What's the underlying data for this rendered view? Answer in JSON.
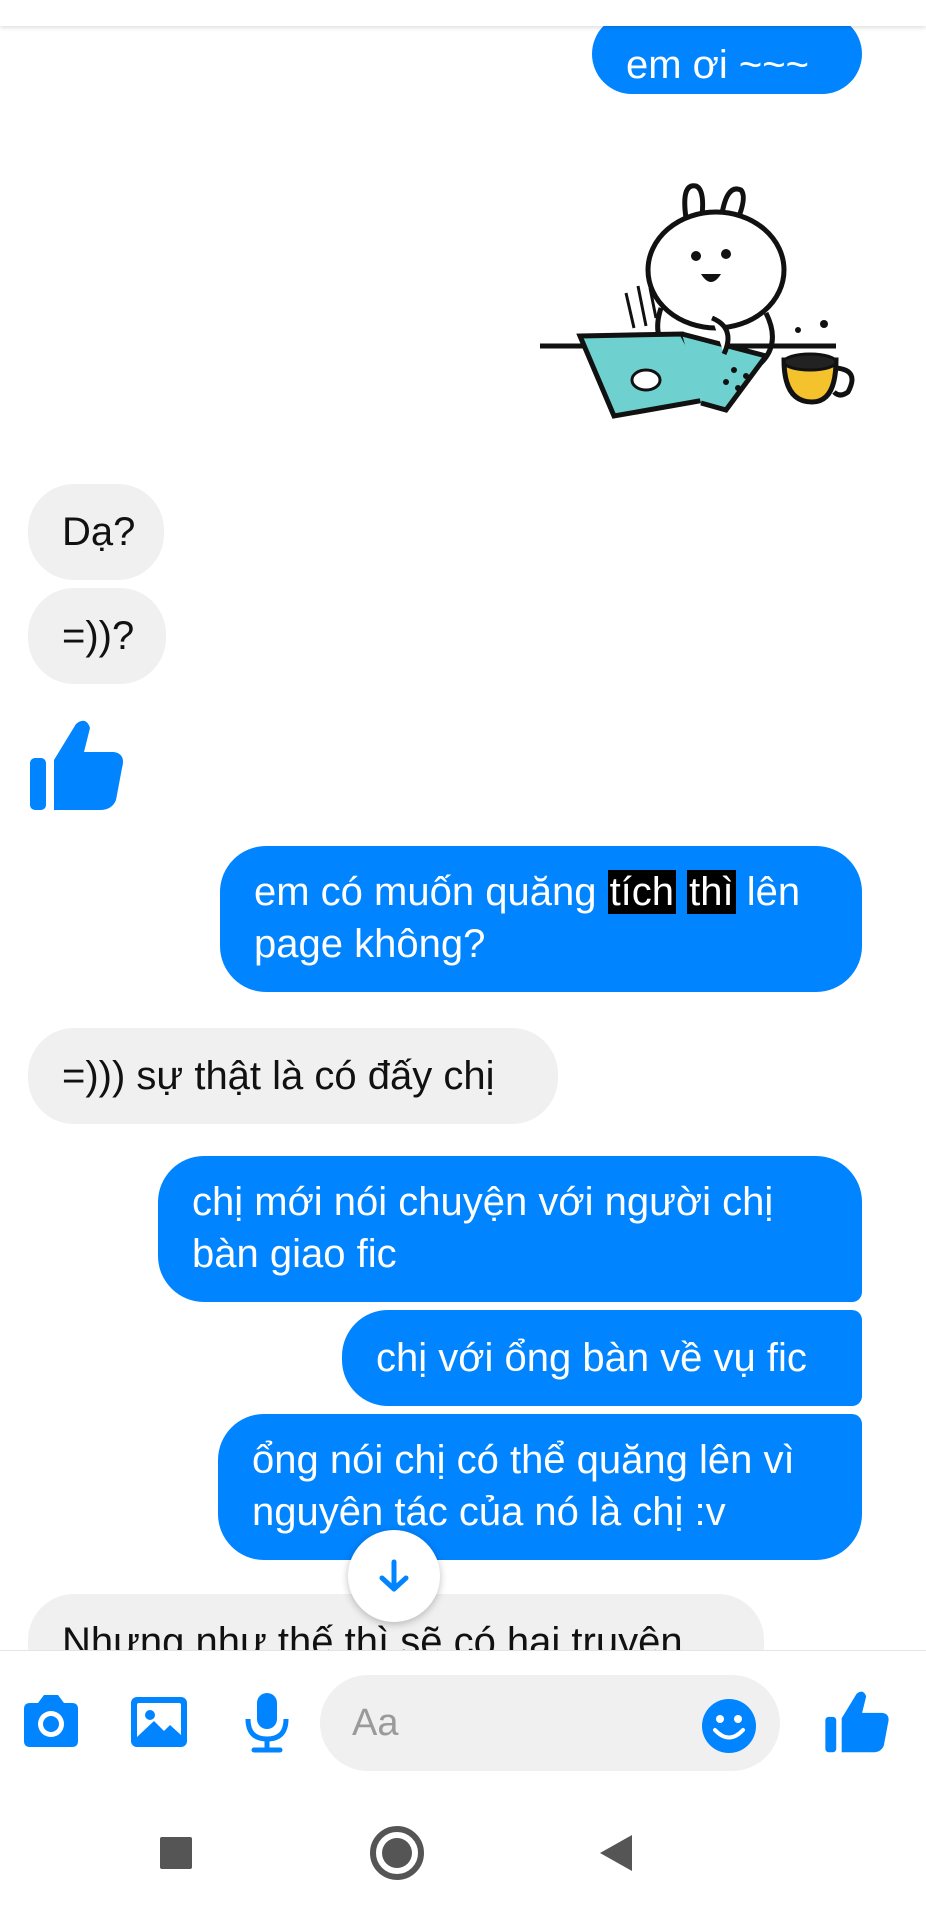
{
  "messages": {
    "m1": "em ơi ~~~",
    "m2": "Dạ?",
    "m3": "=))?",
    "m4_pre": "em có muốn quăng ",
    "m4_hl1": "tích",
    "m4_hl2": "thì",
    "m4_post": " lên",
    "m4_line2": "page không?",
    "m5": "=))) sự thật là có đấy chị",
    "m6_line1": "chị mới nói chuyện với người chị",
    "m6_line2": "bàn giao fic",
    "m7": "chị với ổng bàn về vụ fic",
    "m8_line1": "ổng nói chị có thể quăng lên vì",
    "m8_line2": "nguyên tác của nó là chị :v",
    "m9": "Nhưng như thế thì sẽ có hai truyện"
  },
  "composer": {
    "placeholder": "Aa"
  },
  "colors": {
    "outgoing": "#0084ff",
    "incoming": "#f0f0f0",
    "accent": "#0084ff"
  },
  "icons": [
    "camera-icon",
    "image-icon",
    "microphone-icon",
    "emoji-icon",
    "thumbs-up-icon",
    "arrow-down-icon",
    "rabbit-sticker",
    "back-icon",
    "home-icon",
    "recents-icon"
  ]
}
